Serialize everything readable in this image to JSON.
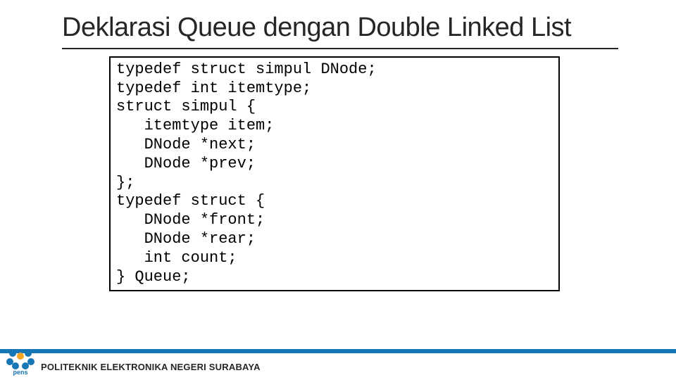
{
  "title": "Deklarasi Queue dengan Double Linked List",
  "code": {
    "l1": "typedef struct simpul DNode;",
    "l2": "typedef int itemtype;",
    "l3": "struct simpul {",
    "l4": "   itemtype item;",
    "l5": "   DNode *next;",
    "l6": "   DNode *prev;",
    "l7": "};",
    "l8": "typedef struct {",
    "l9": "   DNode *front;",
    "l10": "   DNode *rear;",
    "l11": "   int count;",
    "l12": "} Queue;"
  },
  "footer": {
    "institution": "POLITEKNIK ELEKTRONIKA NEGERI SURABAYA",
    "logo_name": "pens"
  }
}
